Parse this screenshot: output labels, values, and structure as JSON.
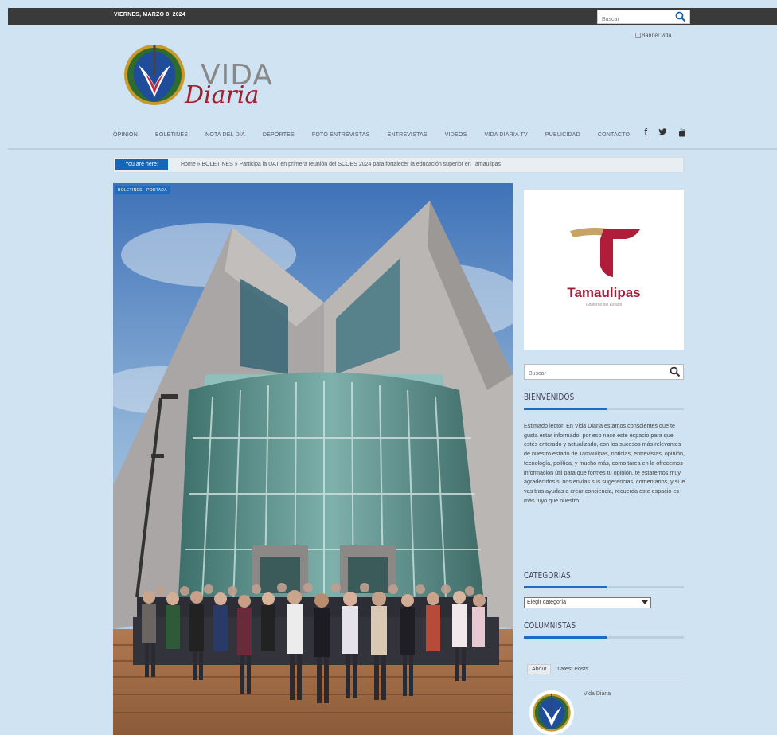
{
  "topbar": {
    "date": "VIERNES, MARZO 8, 2024",
    "search_placeholder": "Buscar"
  },
  "banner_alt": "Banner vida",
  "logo": {
    "word1": "VIDA",
    "word2": "Diaria"
  },
  "nav": {
    "items": [
      "OPINIÓN",
      "BOLETINES",
      "NOTA DEL DÍA",
      "DEPORTES",
      "FOTO ENTREVISTAS",
      "ENTREVISTAS",
      "VIDEOS",
      "VIDA DIARIA TV",
      "PUBLICIDAD",
      "CONTACTO"
    ],
    "social": [
      "f",
      "t",
      "yt"
    ]
  },
  "breadcrumb": {
    "label": "You are here:",
    "path": "Home » BOLETINES » Participa la UAT en primera reunión del SCOES 2024 para fortalecer la educación superior en Tamaulipas"
  },
  "hero": {
    "tag": "BOLETINES · PORTADA"
  },
  "ad": {
    "name": "Tamaulipas",
    "subtitle": "Gobierno del Estado"
  },
  "sidebar": {
    "search_placeholder": "Buscar",
    "welcome_title": "BIENVENIDOS",
    "welcome_text": "Estimado lector, En Vida Diaria estamos conscientes que te gusta estar informado, por eso nace este espacio para que estés enterado y actualizado, con los sucesos más relevantes de nuestro estado de Tamaulipas, noticias, entrevistas, opinión, tecnología, política, y mucho más, como tarea en la ofrecemos información útil para que formes tu opinión, te estaremos muy agradecidos si nos envías sus sugerencias, comentarios, y si le vas tras ayudas a crear conciencia, recuerda este espacio es más tuyo que nuestro.",
    "categories_title": "CATEGORÍAS",
    "categories_select": "Elegir categoría",
    "columnists_title": "COLUMNISTAS",
    "tabs": [
      "About",
      "Latest Posts"
    ],
    "author": "Vida Diaria"
  },
  "colors": {
    "topbar": "#3a3a3a",
    "page_bg": "#cfe3f2",
    "accent": "#1e6cc0",
    "logo_red": "#a0202e"
  }
}
